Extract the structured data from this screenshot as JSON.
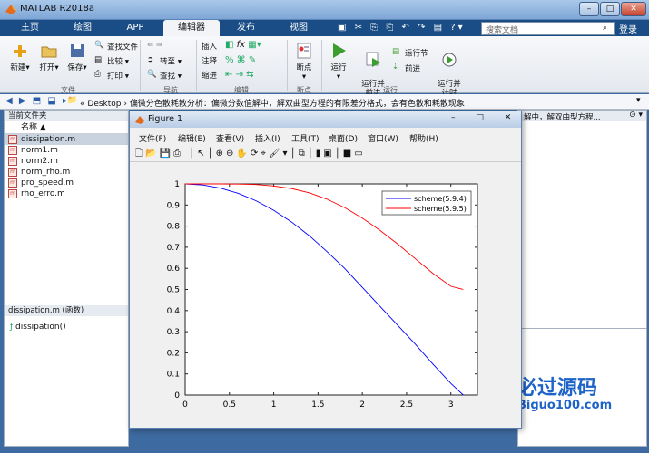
{
  "window": {
    "title": "MATLAB R2018a"
  },
  "tabs": [
    "主页",
    "绘图",
    "APP",
    "编辑器",
    "发布",
    "视图"
  ],
  "active_tab": "编辑器",
  "search": {
    "placeholder": "搜索文档"
  },
  "login": "登录",
  "ribbon": {
    "file": {
      "new": "新建",
      "open": "打开",
      "save": "保存",
      "find_files": "查找文件",
      "compare": "比较",
      "print": "打印",
      "group": "文件"
    },
    "nav": {
      "goto": "转至",
      "find": "查找",
      "group": "导航"
    },
    "edit": {
      "insert": "插入",
      "comment": "注释",
      "indent": "缩进",
      "fx": "fx",
      "group": "编辑"
    },
    "breakpoints": {
      "label": "断点",
      "group": "断点"
    },
    "run": {
      "run": "运行",
      "run_advance": "运行并\n前进",
      "run_section": "运行节",
      "advance": "前进",
      "run_time": "运行并\n计时",
      "group": "运行"
    }
  },
  "path": {
    "prefix": "«",
    "folder": "Desktop",
    "sep": "›",
    "text": "偏微分色散耗散分析：偏微分数值解中，解双曲型方程的有限差分格式，会有色散和耗散现象"
  },
  "current_folder": {
    "title": "当前文件夹",
    "col": "名称 ▲",
    "files": [
      "dissipation.m",
      "norm1.m",
      "norm2.m",
      "norm_rho.m",
      "pro_speed.m",
      "rho_erro.m"
    ],
    "selected": 0
  },
  "details": {
    "title": "dissipation.m  (函数)",
    "item": "dissipation()"
  },
  "right_snippet": "解中，解双曲型方程...",
  "figure": {
    "title": "Figure 1",
    "menu": [
      "文件(F)",
      "编辑(E)",
      "查看(V)",
      "插入(I)",
      "工具(T)",
      "桌面(D)",
      "窗口(W)",
      "帮助(H)"
    ]
  },
  "watermark": {
    "title": "必过源码",
    "url": "Biguo100.com"
  },
  "chart_data": {
    "type": "line",
    "xlim": [
      0,
      3.3
    ],
    "ylim": [
      0,
      1
    ],
    "xticks": [
      0,
      0.5,
      1,
      1.5,
      2,
      2.5,
      3
    ],
    "yticks": [
      0,
      0.1,
      0.2,
      0.3,
      0.4,
      0.5,
      0.6,
      0.7,
      0.8,
      0.9,
      1
    ],
    "legend_position": "top-right",
    "series": [
      {
        "name": "scheme(5.9.4)",
        "color": "#0000ff",
        "x": [
          0,
          0.2,
          0.4,
          0.6,
          0.8,
          1.0,
          1.2,
          1.4,
          1.6,
          1.8,
          2.0,
          2.2,
          2.4,
          2.6,
          2.8,
          3.0,
          3.14
        ],
        "y": [
          1,
          0.995,
          0.98,
          0.955,
          0.92,
          0.875,
          0.82,
          0.755,
          0.68,
          0.6,
          0.51,
          0.42,
          0.33,
          0.24,
          0.145,
          0.055,
          0
        ]
      },
      {
        "name": "scheme(5.9.5)",
        "color": "#ff0000",
        "x": [
          0,
          0.2,
          0.4,
          0.6,
          0.8,
          1.0,
          1.2,
          1.4,
          1.6,
          1.8,
          2.0,
          2.2,
          2.4,
          2.6,
          2.8,
          3.0,
          3.14
        ],
        "y": [
          1,
          1,
          1,
          0.999,
          0.997,
          0.99,
          0.978,
          0.958,
          0.928,
          0.888,
          0.838,
          0.78,
          0.715,
          0.645,
          0.575,
          0.515,
          0.5
        ]
      }
    ]
  },
  "colors": {
    "ribbon_tab_bg": "#1a4d86",
    "accent": "#1a5fb4"
  }
}
